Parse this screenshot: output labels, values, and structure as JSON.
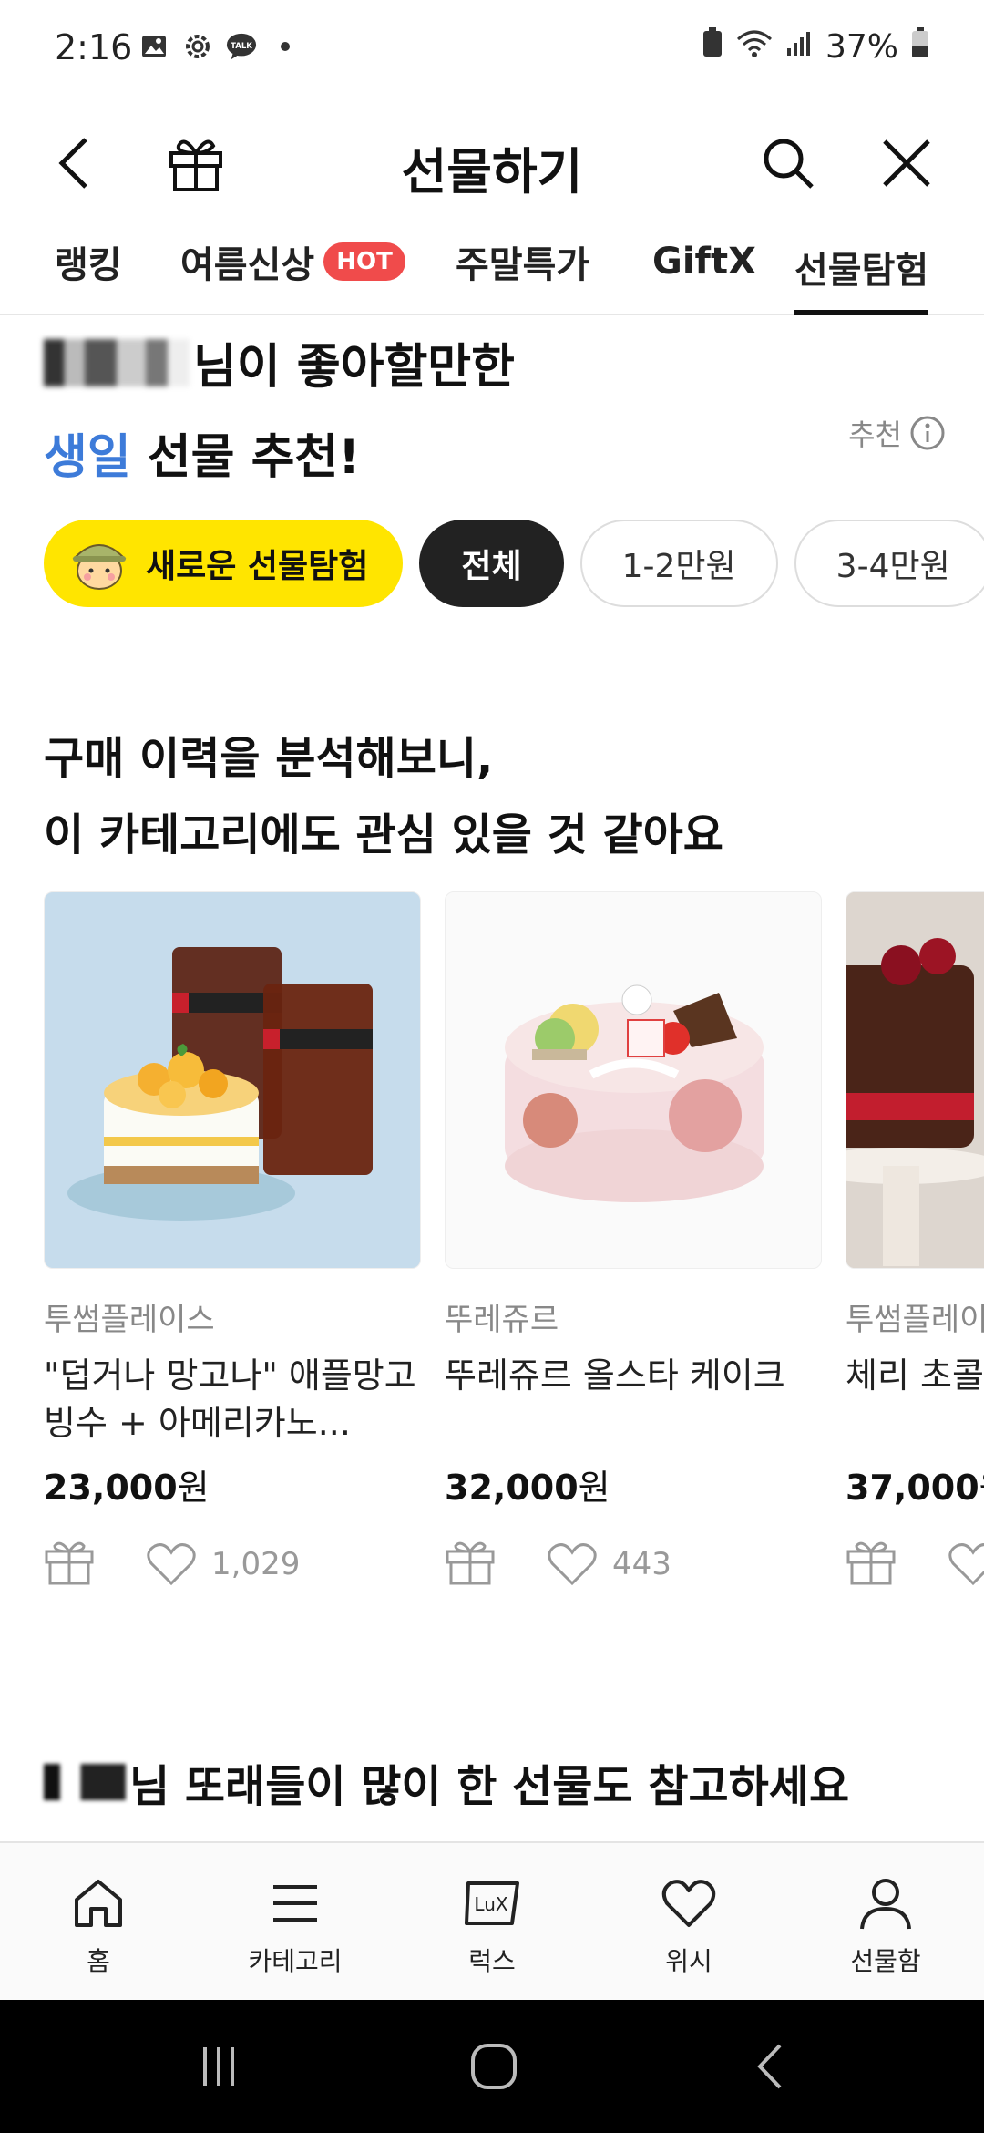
{
  "status_bar": {
    "time": "2:16",
    "battery": "37%"
  },
  "header": {
    "title": "선물하기"
  },
  "tabs": [
    {
      "label": "랭킹"
    },
    {
      "label": "여름신상",
      "badge": "HOT"
    },
    {
      "label": "주말특가"
    },
    {
      "label": "GiftX"
    },
    {
      "label": "선물탐험"
    }
  ],
  "recommendation": {
    "line1_suffix": "님이 좋아할만한",
    "accent": "생일",
    "line2_suffix": " 선물 추천!",
    "info_label": "추천"
  },
  "chips": [
    {
      "label": "새로운 선물탐험"
    },
    {
      "label": "전체"
    },
    {
      "label": "1-2만원"
    },
    {
      "label": "3-4만원"
    }
  ],
  "section": {
    "line1": "구매 이력을 분석해보니,",
    "line2": "이 카테고리에도 관심 있을 것 같아요"
  },
  "products": [
    {
      "brand": "투썸플레이스",
      "name": "\"덥거나 망고나\" 애플망고 빙수 + 아메리카노...",
      "price": "23,000",
      "won": "원",
      "likes": "1,029"
    },
    {
      "brand": "뚜레쥬르",
      "name": "뚜레쥬르 올스타 케이크",
      "price": "32,000",
      "won": "원",
      "likes": "443"
    },
    {
      "brand": "투썸플레이스",
      "name": "체리 초콜",
      "price": "37,000",
      "won": "원",
      "likes": ""
    }
  ],
  "section2": {
    "suffix": "님 또래들이 많이 한 선물도 참고하세요"
  },
  "bottom_nav": [
    {
      "label": "홈",
      "icon": "home-icon"
    },
    {
      "label": "카테고리",
      "icon": "menu-icon"
    },
    {
      "label": "럭스",
      "icon": "lux-icon"
    },
    {
      "label": "위시",
      "icon": "heart-icon"
    },
    {
      "label": "선물함",
      "icon": "person-icon"
    }
  ],
  "colors": {
    "accent_blue": "#3d7bd9",
    "chip_yellow": "#ffe500",
    "hot_red": "#f04b4b"
  }
}
